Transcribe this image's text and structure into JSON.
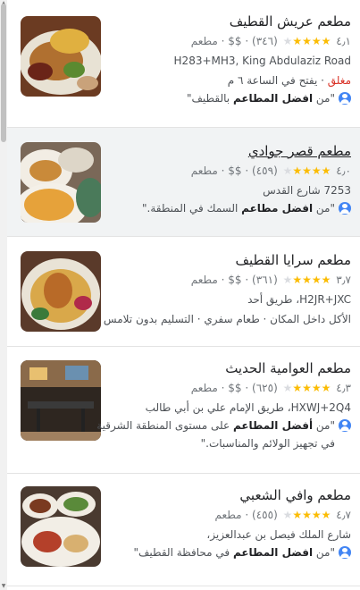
{
  "results": [
    {
      "name": "مطعم عريش القطيف",
      "rating": "٤٫١",
      "stars": "★★★★",
      "stars_empty": "★",
      "count": "(٣٤٦)",
      "price": "$$",
      "category": "مطعم",
      "address": "H283+MH3, King Abdulaziz Road",
      "status_closed": "مغلق",
      "status_detail": " · يفتح في الساعة ٦ م",
      "quote_prefix": "\"من ",
      "quote_bold": "افضل المطاعم",
      "quote_rest": " بالقطيف\""
    },
    {
      "name": "مطعم قصر جوادي",
      "rating": "٤٫٠",
      "stars": "★★★★",
      "stars_empty": "★",
      "count": "(٤٥٩)",
      "price": "$$",
      "category": "مطعم",
      "address": "7253 شارع القدس",
      "quote_prefix": "\"من ",
      "quote_bold": "افضل مطاعم",
      "quote_rest": " السمك في المنطقة.\""
    },
    {
      "name": "مطعم سرايا القطيف",
      "rating": "٣٫٧",
      "stars": "★★★★",
      "stars_empty": "★",
      "count": "(٣٦١)",
      "price": "$$",
      "category": "مطعم",
      "address": "H2JR+JXC، طريق أحد",
      "services": "الأكل داخل المكان · طعام سفري · التسليم بدون تلامس"
    },
    {
      "name": "مطعم العوامية الحديث",
      "rating": "٤٫٣",
      "stars": "★★★★",
      "stars_empty": "★",
      "count": "(٦٢٥)",
      "price": "$$",
      "category": "مطعم",
      "address": "HXWJ+2Q4، طريق الإمام علي بن أبي طالب",
      "quote_prefix": "\"من ",
      "quote_bold": "أفضل المطاعم",
      "quote_rest": " على مستوى المنطقة الشرقية",
      "quote_line2": "في تجهيز الولائم والمناسبات.\""
    },
    {
      "name": "مطعم وافي الشعبي",
      "rating": "٤٫٧",
      "stars": "★★★★",
      "stars_empty": "★",
      "count": "(٤٥٥)",
      "price": "",
      "category": "مطعم",
      "address": "شارع الملك فيصل بن عبدالعزيز،",
      "quote_prefix": "\"من ",
      "quote_bold": "افضل المطاعم",
      "quote_rest": " في محافظة القطيف\""
    }
  ]
}
